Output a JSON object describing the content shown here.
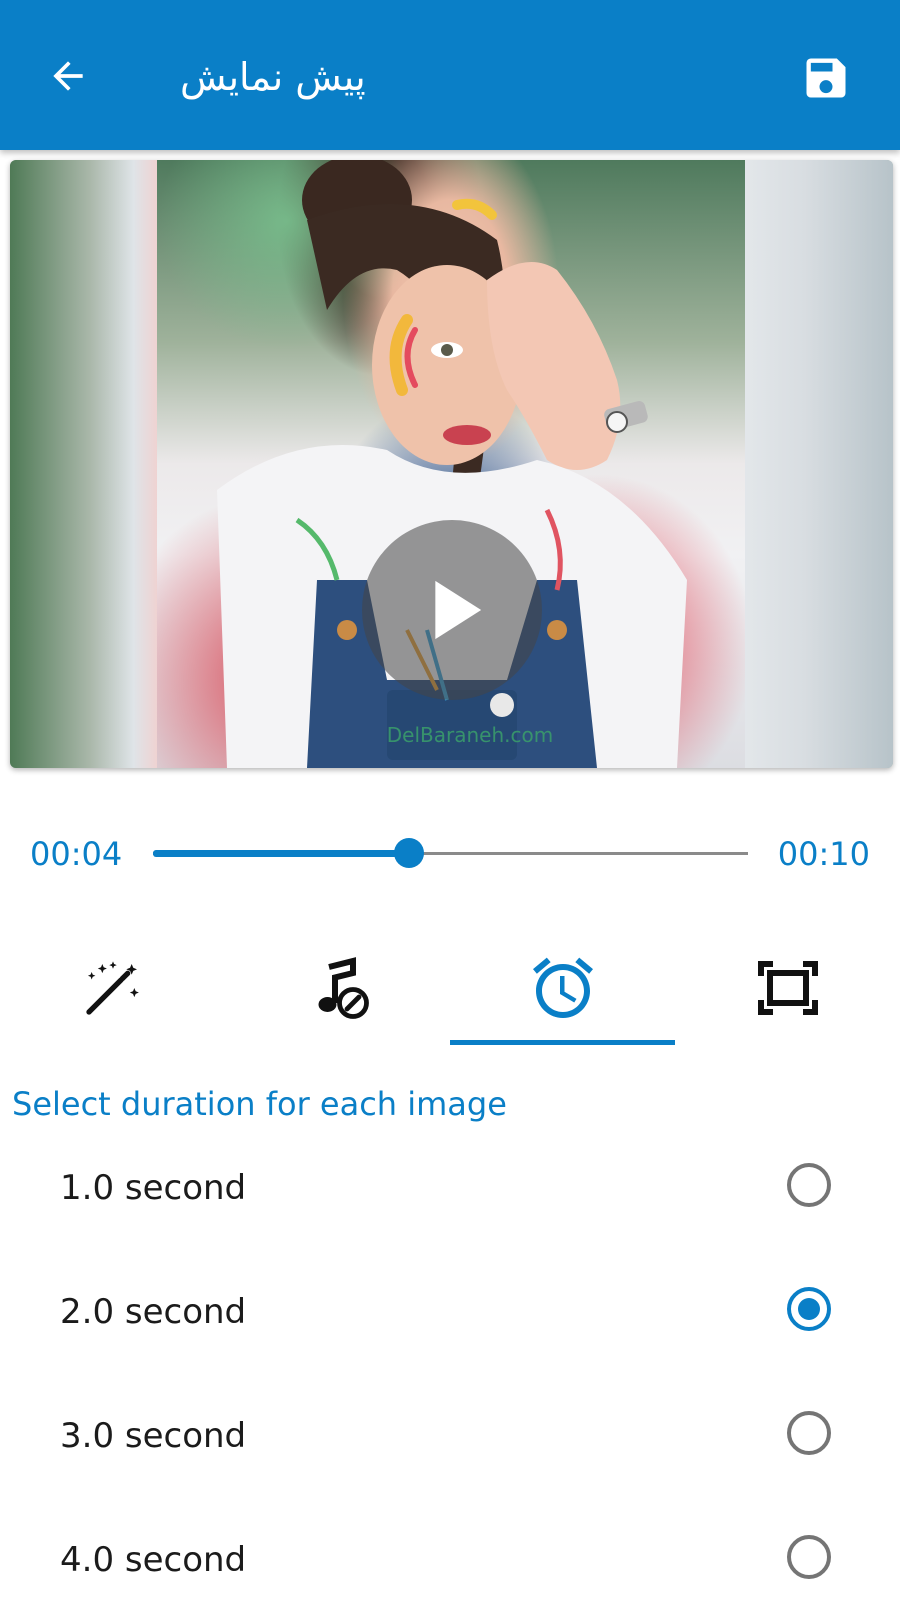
{
  "app_bar": {
    "title": "پیش نمایش",
    "back_icon": "arrow-left-icon",
    "save_icon": "floppy-disk-icon",
    "color": "#0a7fc7"
  },
  "preview": {
    "watermark": "DelBaraneh.com",
    "play_icon": "play-icon"
  },
  "player": {
    "current_time": "00:04",
    "total_time": "00:10",
    "progress_percent": 43
  },
  "tabs": [
    {
      "name": "effects",
      "icon": "magic-wand-icon",
      "selected": false
    },
    {
      "name": "music",
      "icon": "music-note-icon",
      "selected": false
    },
    {
      "name": "duration",
      "icon": "alarm-clock-icon",
      "selected": true
    },
    {
      "name": "frame",
      "icon": "frame-icon",
      "selected": false
    }
  ],
  "duration_section": {
    "label": "Select duration for each image",
    "options": [
      {
        "label": "1.0 second",
        "selected": false
      },
      {
        "label": "2.0 second",
        "selected": true
      },
      {
        "label": "3.0 second",
        "selected": false
      },
      {
        "label": "4.0 second",
        "selected": false
      }
    ]
  }
}
